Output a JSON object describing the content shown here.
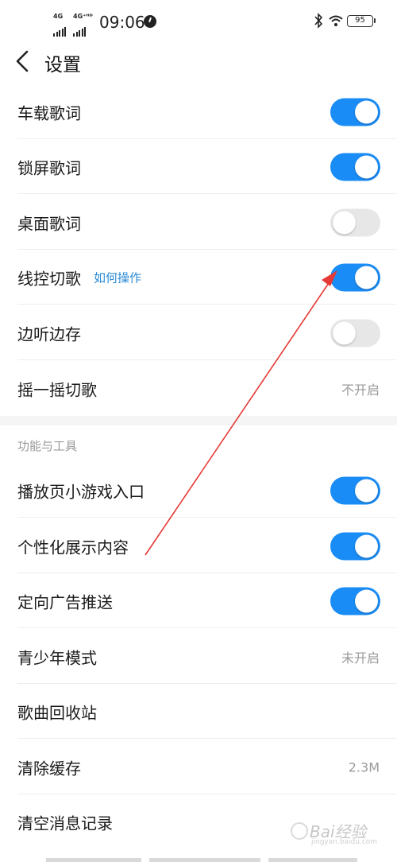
{
  "status_bar": {
    "net1": "4G",
    "net2": "4G⁺ᴴᴰ",
    "time": "09:06",
    "battery": "95"
  },
  "header": {
    "title": "设置"
  },
  "rows": {
    "car_lyrics": {
      "label": "车载歌词",
      "on": true
    },
    "lock_lyrics": {
      "label": "锁屏歌词",
      "on": true
    },
    "desktop_lyrics": {
      "label": "桌面歌词",
      "on": false
    },
    "wire_control": {
      "label": "线控切歌",
      "link": "如何操作",
      "on": true
    },
    "listen_save": {
      "label": "边听边存",
      "on": false
    },
    "shake": {
      "label": "摇一摇切歌",
      "value": "不开启"
    },
    "mini_game": {
      "label": "播放页小游戏入口",
      "on": true
    },
    "personalized": {
      "label": "个性化展示内容",
      "on": true
    },
    "targeted_ads": {
      "label": "定向广告推送",
      "on": true
    },
    "teen_mode": {
      "label": "青少年模式",
      "value": "未开启"
    },
    "recycle_bin": {
      "label": "歌曲回收站"
    },
    "clear_cache": {
      "label": "清除缓存",
      "value": "2.3M"
    },
    "clear_messages": {
      "label": "清空消息记录"
    }
  },
  "section": {
    "tools_title": "功能与工具"
  },
  "watermark": {
    "text": "Bai经验",
    "sub": "jingyan.baidu.com"
  },
  "colors": {
    "toggle_on": "#1a8cf5",
    "toggle_off": "#e7e7e7",
    "link": "#2a8ad6",
    "annotation_arrow": "#e53935"
  },
  "icons": [
    "back-arrow-icon",
    "bluetooth-icon",
    "wifi-icon",
    "battery-icon",
    "clock-icon"
  ]
}
